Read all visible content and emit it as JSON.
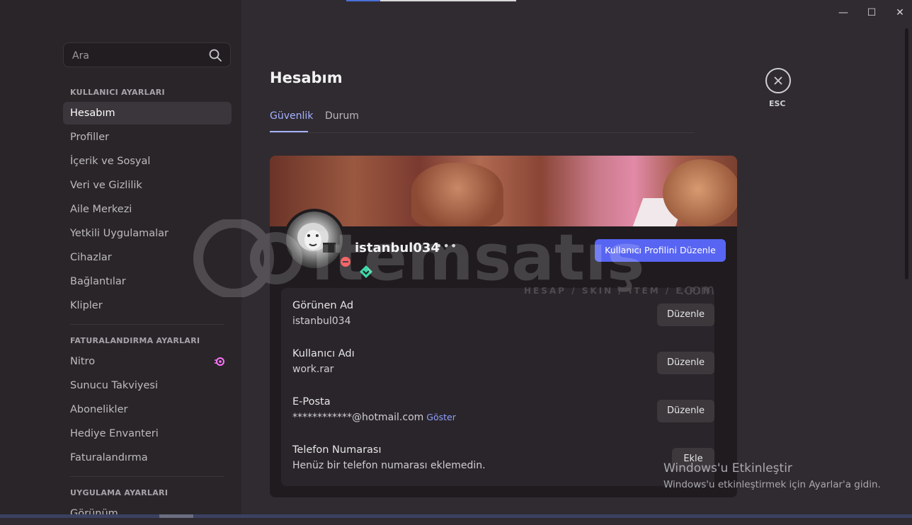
{
  "search": {
    "placeholder": "Ara"
  },
  "sidebar": {
    "user_settings": {
      "title": "KULLANICI AYARLARI",
      "items": [
        "Hesabım",
        "Profiller",
        "İçerik ve Sosyal",
        "Veri ve Gizlilik",
        "Aile Merkezi",
        "Yetkili Uygulamalar",
        "Cihazlar",
        "Bağlantılar",
        "Klipler"
      ],
      "active": "Hesabım"
    },
    "billing_settings": {
      "title": "FATURALANDIRMA AYARLARI",
      "items": [
        "Nitro",
        "Sunucu Takviyesi",
        "Abonelikler",
        "Hediye Envanteri",
        "Faturalandırma"
      ]
    },
    "app_settings": {
      "title": "UYGULAMA AYARLARI",
      "items": [
        "Görünüm"
      ]
    }
  },
  "window": {
    "minimize": "—",
    "maximize": "☐",
    "close": "✕"
  },
  "main": {
    "title": "Hesabım",
    "tabs": [
      {
        "label": "Güvenlik",
        "active": true
      },
      {
        "label": "Durum",
        "active": false
      }
    ],
    "esc_label": "ESC"
  },
  "profile": {
    "username": "istanbul034",
    "more": "•••",
    "edit_profile_button": "Kullanıcı Profilini Düzenle",
    "fields": [
      {
        "label": "Görünen Ad",
        "value": "istanbul034",
        "button": "Düzenle"
      },
      {
        "label": "Kullanıcı Adı",
        "value": "work.rar",
        "button": "Düzenle"
      },
      {
        "label": "E-Posta",
        "value": "************@hotmail.com",
        "reveal": "Göster",
        "button": "Düzenle"
      },
      {
        "label": "Telefon Numarası",
        "value": "Henüz bir telefon numarası eklemedin.",
        "button": "Ekle"
      }
    ]
  },
  "watermark": {
    "brand": "itemsatış",
    "tagline": "HESAP / SKIN / ITEM / E-PIN",
    "suffix": ".com"
  },
  "activation": {
    "title": "Windows'u Etkinleştir",
    "subtitle": "Windows'u etkinleştirmek için Ayarlar'a gidin."
  },
  "colors": {
    "accent": "#5865f2",
    "tab_active": "#a4b2ff",
    "dnd_status": "#f0474a",
    "nitro": "#ff73fa"
  }
}
